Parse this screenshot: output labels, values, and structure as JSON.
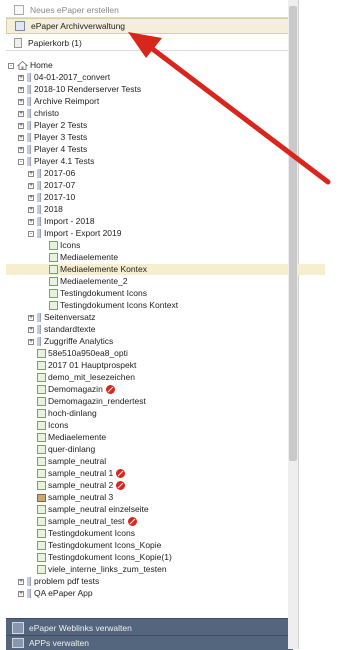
{
  "top_buttons": {
    "new_label": "Neues ePaper erstellen",
    "archive_label": "ePaper Archivverwaltung",
    "trash_label": "Papierkorb (1)"
  },
  "tree": {
    "root": "Home",
    "items": [
      {
        "label": "04-01-2017_convert",
        "type": "folder",
        "depth": 1,
        "toggle": "+"
      },
      {
        "label": "2018-10 Renderserver Tests",
        "type": "folder",
        "depth": 1,
        "toggle": "+"
      },
      {
        "label": "Archive Reimport",
        "type": "folder",
        "depth": 1,
        "toggle": "+"
      },
      {
        "label": "christo",
        "type": "folder",
        "depth": 1,
        "toggle": "+"
      },
      {
        "label": "Player 2 Tests",
        "type": "folder",
        "depth": 1,
        "toggle": "+"
      },
      {
        "label": "Player 3 Tests",
        "type": "folder",
        "depth": 1,
        "toggle": "+"
      },
      {
        "label": "Player 4 Tests",
        "type": "folder",
        "depth": 1,
        "toggle": "+"
      },
      {
        "label": "Player 4.1 Tests",
        "type": "folder",
        "depth": 1,
        "toggle": "-"
      },
      {
        "label": "2017-06",
        "type": "folder",
        "depth": 2,
        "toggle": "+"
      },
      {
        "label": "2017-07",
        "type": "folder",
        "depth": 2,
        "toggle": "+"
      },
      {
        "label": "2017-10",
        "type": "folder",
        "depth": 2,
        "toggle": "+"
      },
      {
        "label": "2018",
        "type": "folder",
        "depth": 2,
        "toggle": "+"
      },
      {
        "label": "Import - 2018",
        "type": "folder",
        "depth": 2,
        "toggle": "+"
      },
      {
        "label": "Import - Export 2019",
        "type": "folder",
        "depth": 2,
        "toggle": "-"
      },
      {
        "label": "Icons",
        "type": "doc",
        "depth": 3
      },
      {
        "label": "Mediaelemente",
        "type": "doc",
        "depth": 3
      },
      {
        "label": "Mediaelemente Kontex",
        "type": "doc",
        "depth": 3,
        "selected": true
      },
      {
        "label": "Mediaelemente_2",
        "type": "doc",
        "depth": 3
      },
      {
        "label": "Testingdokument Icons",
        "type": "doc",
        "depth": 3
      },
      {
        "label": "Testingdokument Icons Kontext",
        "type": "doc",
        "depth": 3
      },
      {
        "label": "Seitenversatz",
        "type": "folder",
        "depth": 2,
        "toggle": "+"
      },
      {
        "label": "standardtexte",
        "type": "folder",
        "depth": 2,
        "toggle": "+"
      },
      {
        "label": "Zuggriffe Analytics",
        "type": "folder",
        "depth": 2,
        "toggle": "+"
      },
      {
        "label": "58e510a950ea8_opti",
        "type": "doc",
        "depth": 2
      },
      {
        "label": "2017 01 Hauptprospekt",
        "type": "doc",
        "depth": 2
      },
      {
        "label": "demo_mit_lesezeichen",
        "type": "doc",
        "depth": 2
      },
      {
        "label": "Demomagazin",
        "type": "doc",
        "depth": 2,
        "badge": true
      },
      {
        "label": "Demomagazin_rendertest",
        "type": "doc",
        "depth": 2
      },
      {
        "label": "hoch-dinlang",
        "type": "doc",
        "depth": 2
      },
      {
        "label": "Icons",
        "type": "doc",
        "depth": 2
      },
      {
        "label": "Mediaelemente",
        "type": "doc",
        "depth": 2
      },
      {
        "label": "quer-dinlang",
        "type": "doc",
        "depth": 2
      },
      {
        "label": "sample_neutral",
        "type": "doc",
        "depth": 2
      },
      {
        "label": "sample_neutral 1",
        "type": "doc",
        "depth": 2,
        "badge": true
      },
      {
        "label": "sample_neutral 2",
        "type": "doc",
        "depth": 2,
        "badge": true
      },
      {
        "label": "sample_neutral 3",
        "type": "box",
        "depth": 2
      },
      {
        "label": "sample_neutral einzelseite",
        "type": "doc",
        "depth": 2
      },
      {
        "label": "sample_neutral_test",
        "type": "doc",
        "depth": 2,
        "badge": true
      },
      {
        "label": "Testingdokument Icons",
        "type": "doc",
        "depth": 2
      },
      {
        "label": "Testingdokument Icons_Kopie",
        "type": "doc",
        "depth": 2
      },
      {
        "label": "Testingdokument Icons_Kopie(1)",
        "type": "doc",
        "depth": 2
      },
      {
        "label": "viele_interne_links_zum_testen",
        "type": "doc",
        "depth": 2
      },
      {
        "label": "problem pdf tests",
        "type": "folder",
        "depth": 1,
        "toggle": "+"
      },
      {
        "label": "QA ePaper App",
        "type": "folder",
        "depth": 1,
        "toggle": "+"
      }
    ]
  },
  "footer": {
    "weblinks_label": "ePaper Weblinks verwalten",
    "apps_label": "APPs verwalten"
  },
  "colors": {
    "arrow": "#d9261c",
    "selected": "#f6efcf",
    "footer": "#54657e"
  }
}
